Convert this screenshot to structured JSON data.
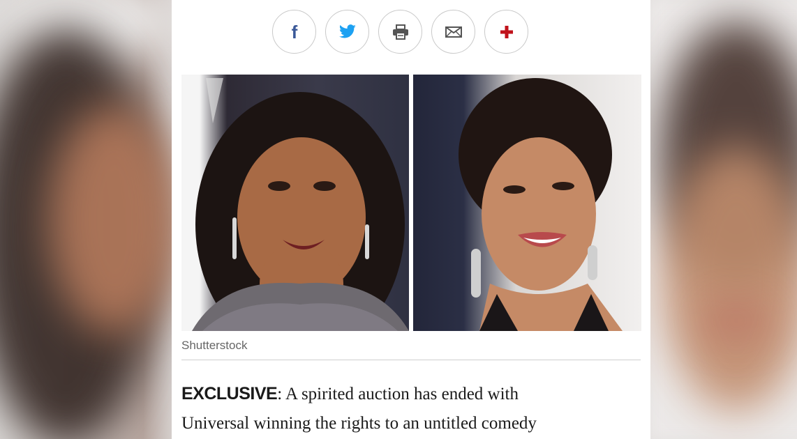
{
  "share": {
    "buttons": [
      {
        "icon": "facebook-icon",
        "color": "#3b5998"
      },
      {
        "icon": "twitter-icon",
        "color": "#1da1f2"
      },
      {
        "icon": "print-icon",
        "color": "#555555"
      },
      {
        "icon": "email-icon",
        "color": "#555555"
      },
      {
        "icon": "more-plus-icon",
        "color": "#c0121b"
      }
    ],
    "facebook_glyph": "f",
    "plus_glyph": "+"
  },
  "article": {
    "photo_caption": "Shutterstock",
    "lead": "EXCLUSIVE",
    "lead_sep": ":",
    "body_line1": " A spirited auction has ended with",
    "body_line2": "Universal winning the rights to an untitled comedy"
  }
}
